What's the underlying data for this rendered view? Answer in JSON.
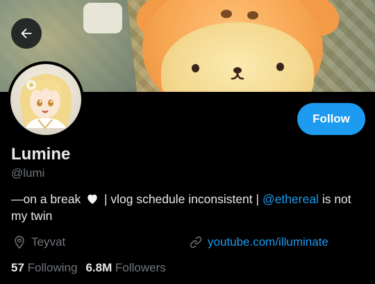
{
  "profile": {
    "display_name": "Lumine",
    "handle": "@lumi",
    "bio_part1": "—on a break",
    "bio_part2": "| vlog schedule inconsistent |",
    "bio_mention": "@ethereal",
    "bio_part3": "is not my twin",
    "location": "Teyvat",
    "website": "youtube.com/illuminate"
  },
  "stats": {
    "following_count": "57",
    "following_label": "Following",
    "followers_count": "6.8M",
    "followers_label": "Followers"
  },
  "actions": {
    "follow_label": "Follow"
  },
  "icons": {
    "back": "arrow-left-icon",
    "location": "location-pin-icon",
    "link": "link-icon",
    "heart": "white-heart-icon"
  },
  "colors": {
    "accent": "#1d9bf0",
    "background": "#000000",
    "text_primary": "#e7e9ea",
    "text_secondary": "#71767b"
  }
}
